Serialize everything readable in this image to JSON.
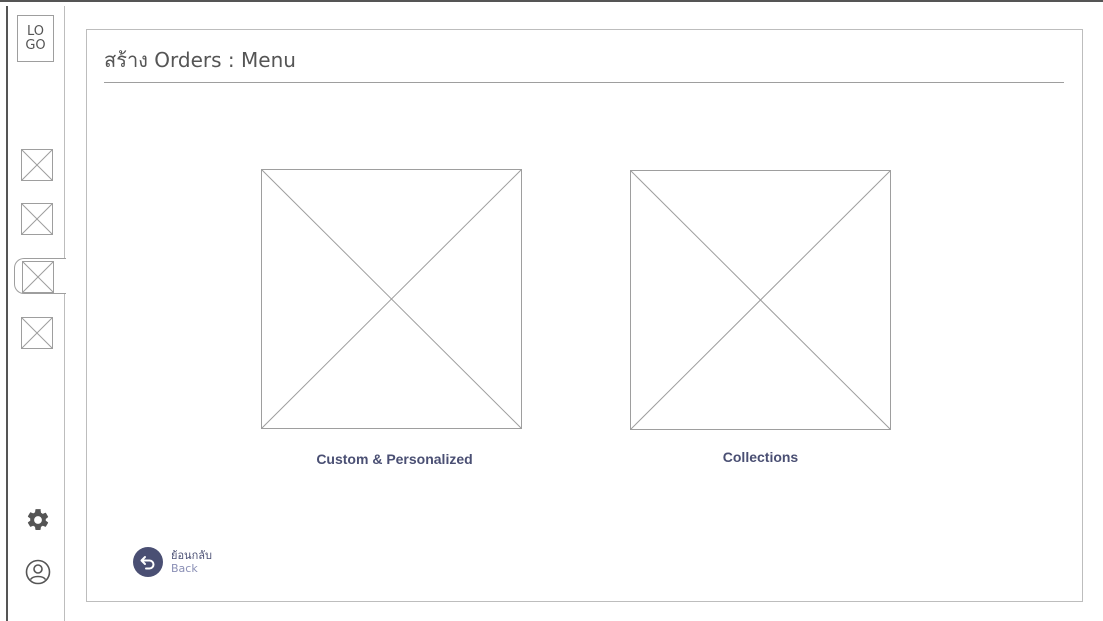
{
  "logo": {
    "text": "LO\nGO"
  },
  "sidebar": {
    "items": [
      {
        "icon": "placeholder-image-icon",
        "active": false
      },
      {
        "icon": "placeholder-image-icon",
        "active": false
      },
      {
        "icon": "placeholder-image-icon",
        "active": true
      },
      {
        "icon": "placeholder-image-icon",
        "active": false
      }
    ],
    "settings_icon": "gear-icon",
    "profile_icon": "user-icon"
  },
  "page": {
    "title": "สร้าง Orders : Menu"
  },
  "cards": [
    {
      "label": "Custom & Personalized",
      "icon": "placeholder-image-icon"
    },
    {
      "label": "Collections",
      "icon": "placeholder-image-icon"
    }
  ],
  "back": {
    "label_th": "ย้อนกลับ",
    "label_en": "Back",
    "icon": "undo-arrow-icon"
  },
  "colors": {
    "accent": "#4a4f73",
    "muted": "#8a8fb5",
    "line": "#9e9e9e"
  }
}
